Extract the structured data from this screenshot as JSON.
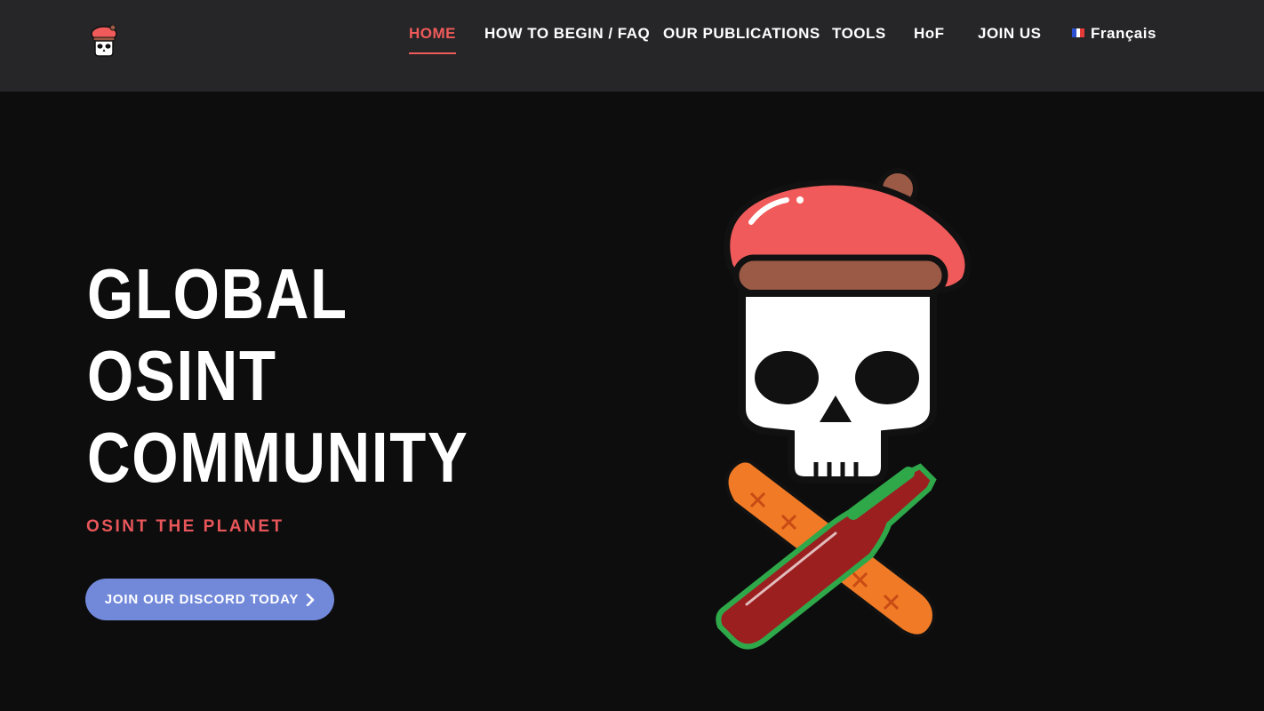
{
  "header": {
    "logo_icon": "skull-beret-icon",
    "nav": {
      "home": "HOME",
      "how_to_begin": "HOW TO BEGIN / FAQ",
      "publications": "OUR PUBLICATIONS",
      "tools": "TOOLS",
      "hof": "HoF",
      "join_us": "JOIN US",
      "language": "Français"
    },
    "active_item": "HOME",
    "language_flag_icon": "french-flag-icon"
  },
  "hero": {
    "headline": [
      "GLOBAL",
      "OSINT",
      "COMMUNITY"
    ],
    "tagline": "OSINT THE PLANET",
    "cta_label": "JOIN OUR DISCORD TODAY",
    "cta_icon": "chevron-right-icon",
    "illustration": "skull-beret-baguette-wine-icon"
  },
  "colors": {
    "accent": "#f05a5a",
    "discord": "#7289da",
    "header_bg": "#262628",
    "page_bg": "#0d0d0e"
  }
}
